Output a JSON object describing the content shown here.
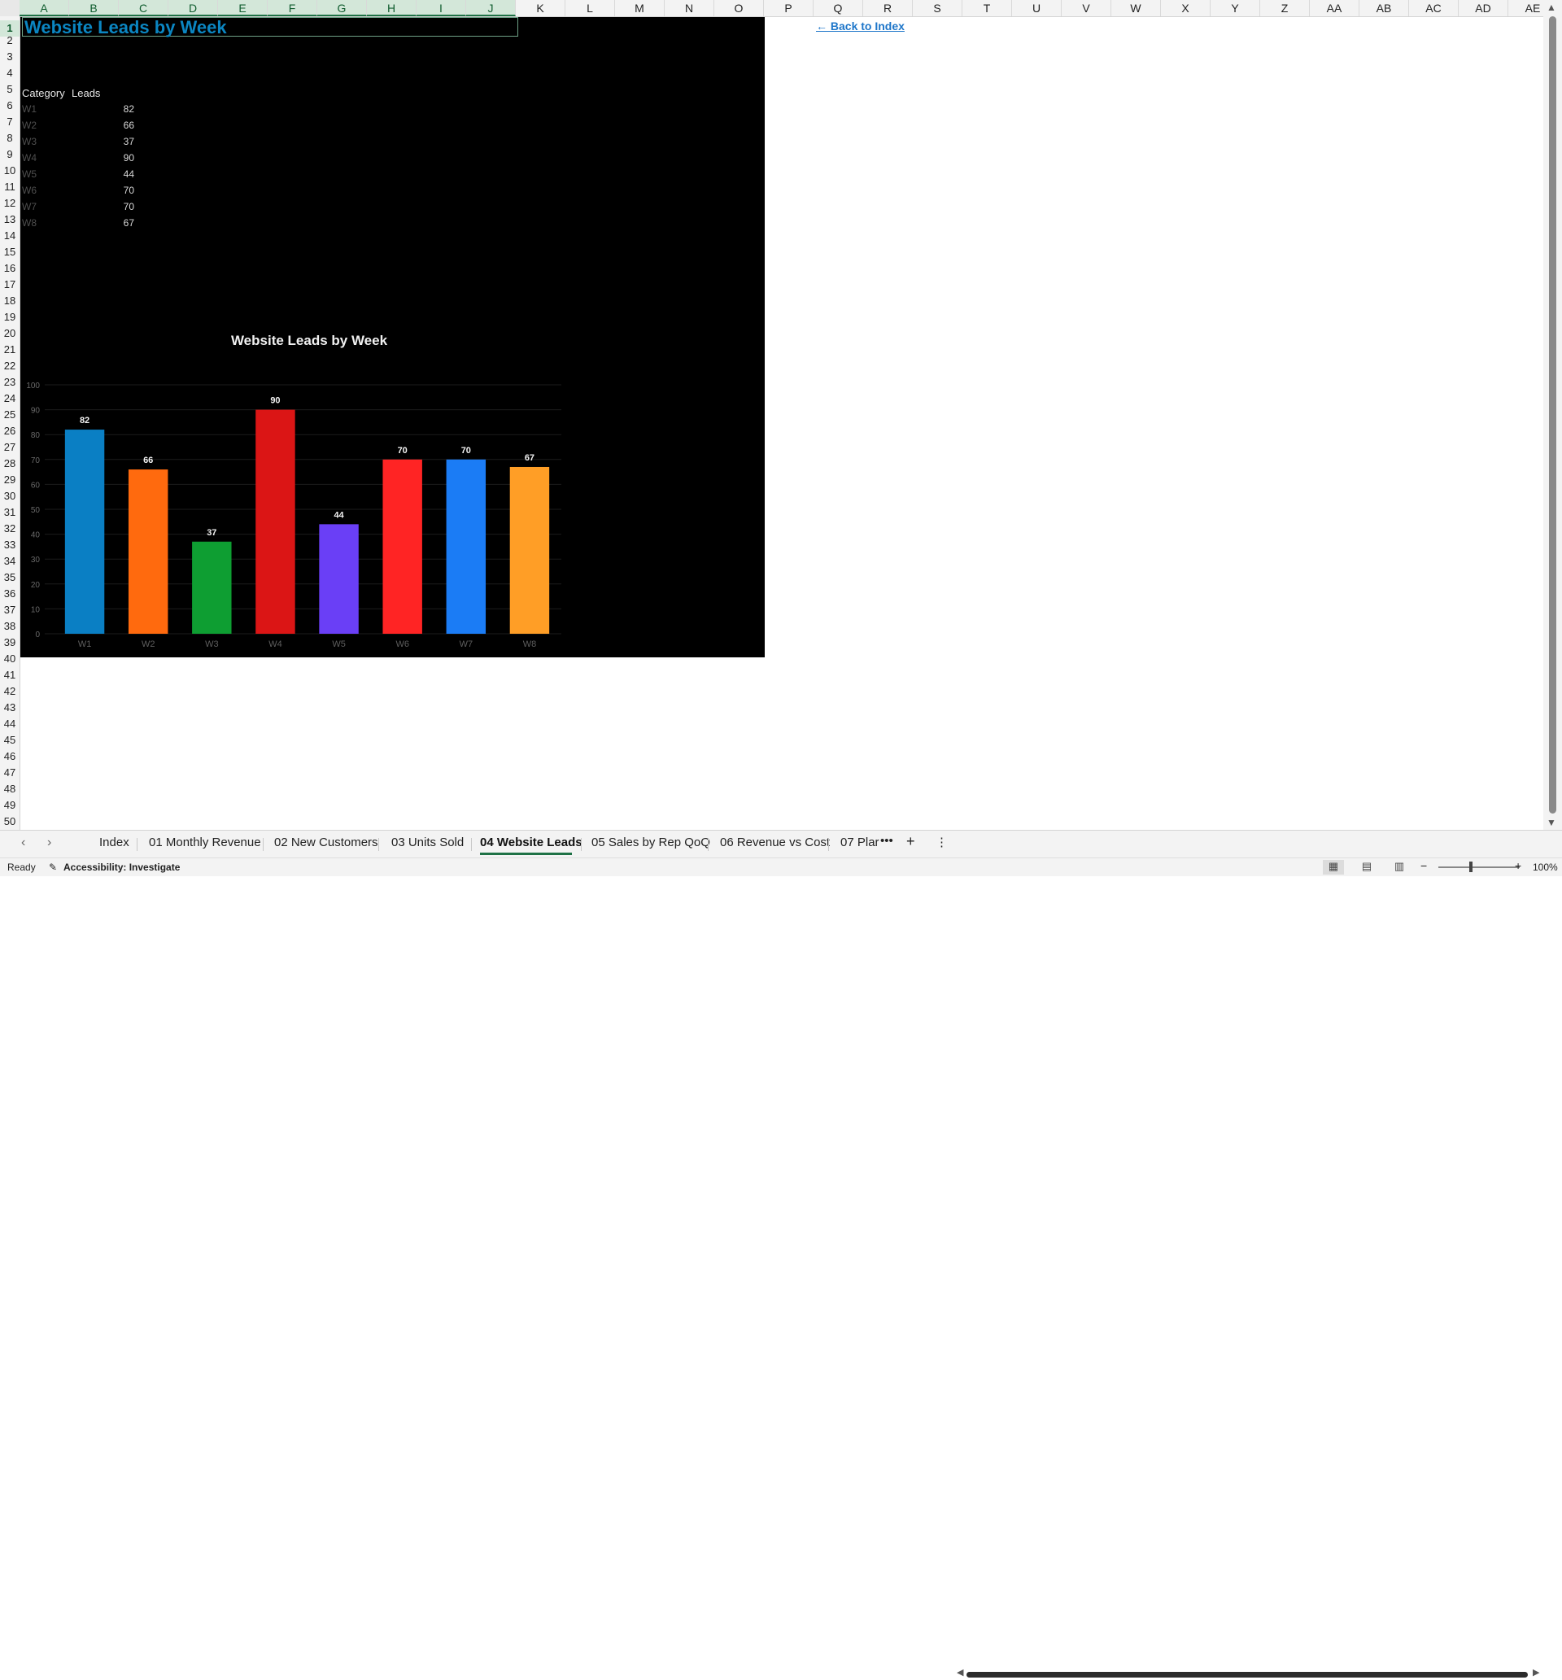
{
  "columns": [
    "A",
    "B",
    "C",
    "D",
    "E",
    "F",
    "G",
    "H",
    "I",
    "J",
    "K",
    "L",
    "M",
    "N",
    "O",
    "P",
    "Q",
    "R",
    "S",
    "T",
    "U",
    "V",
    "W",
    "X",
    "Y",
    "Z",
    "AA",
    "AB",
    "AC",
    "AD",
    "AE"
  ],
  "rows": [
    "1",
    "2",
    "3",
    "4",
    "5",
    "6",
    "7",
    "8",
    "9",
    "10",
    "11",
    "12",
    "13",
    "14",
    "15",
    "16",
    "17",
    "18",
    "19",
    "20",
    "21",
    "22",
    "23",
    "24",
    "25",
    "26",
    "27",
    "28",
    "29",
    "30",
    "31",
    "32",
    "33",
    "34",
    "35",
    "36",
    "37",
    "38",
    "39",
    "40",
    "41",
    "42",
    "43",
    "44",
    "45",
    "46",
    "47",
    "48",
    "49",
    "50"
  ],
  "sheet": {
    "title": "Website Leads by Week",
    "back_link": "← Back to Index",
    "table": {
      "headers": [
        "Category",
        "Leads"
      ],
      "rows": [
        {
          "category": "W1",
          "leads": "82"
        },
        {
          "category": "W2",
          "leads": "66"
        },
        {
          "category": "W3",
          "leads": "37"
        },
        {
          "category": "W4",
          "leads": "90"
        },
        {
          "category": "W5",
          "leads": "44"
        },
        {
          "category": "W6",
          "leads": "70"
        },
        {
          "category": "W7",
          "leads": "70"
        },
        {
          "category": "W8",
          "leads": "67"
        }
      ]
    }
  },
  "chart_data": {
    "type": "bar",
    "title": "Website Leads by Week",
    "categories": [
      "W1",
      "W2",
      "W3",
      "W4",
      "W5",
      "W6",
      "W7",
      "W8"
    ],
    "values": [
      82,
      66,
      37,
      90,
      44,
      70,
      70,
      67
    ],
    "colors": [
      "#0a7fc4",
      "#ff6a0e",
      "#0e9e32",
      "#db1515",
      "#6a3ff6",
      "#ff2424",
      "#1b7cf5",
      "#ff9e26"
    ],
    "ylim": [
      0,
      100
    ],
    "yticks": [
      0,
      10,
      20,
      30,
      40,
      50,
      60,
      70,
      80,
      90,
      100
    ],
    "xlabel": "",
    "ylabel": "",
    "grid": true,
    "data_labels": true
  },
  "tabs": {
    "items": [
      "Index",
      "01 Monthly Revenue",
      "02 New Customers",
      "03 Units Sold",
      "04 Website Leads",
      "05 Sales by Rep QoQ",
      "06 Revenue vs Cost",
      "07 Plar"
    ],
    "active": "04 Website Leads",
    "more": "•••",
    "add": "+",
    "options": "⋮"
  },
  "status": {
    "ready": "Ready",
    "accessibility": "Accessibility: Investigate",
    "zoom": "100%"
  }
}
